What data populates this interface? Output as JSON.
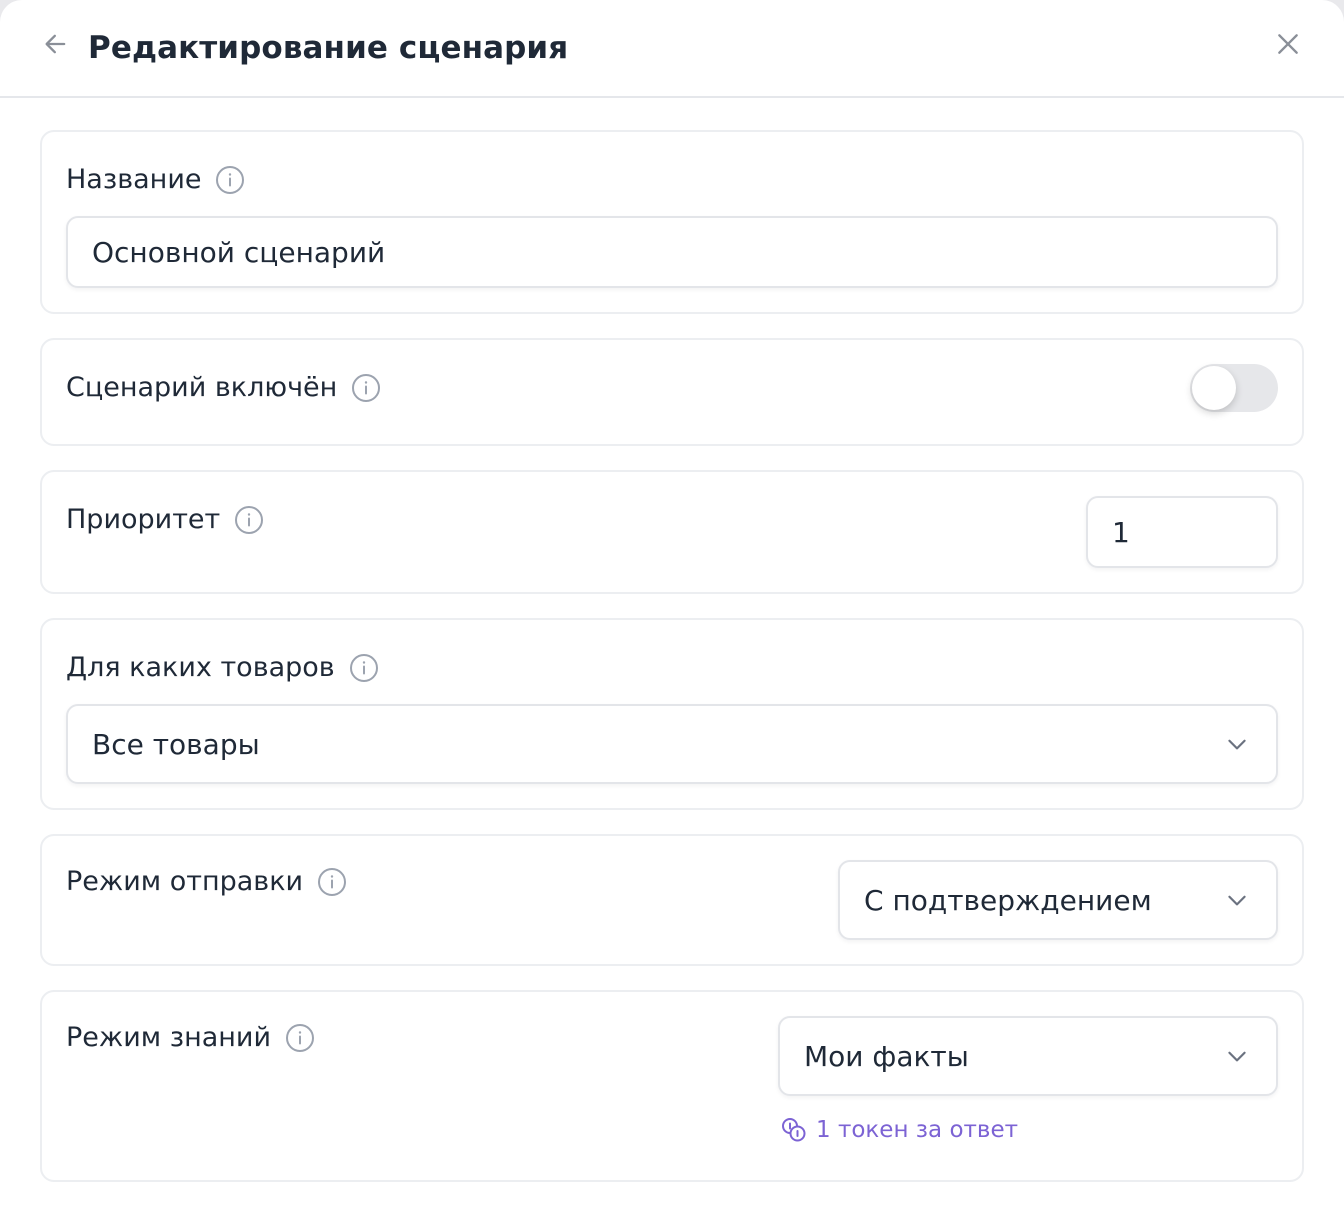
{
  "header": {
    "title": "Редактирование сценария"
  },
  "name_section": {
    "label": "Название",
    "value": "Основной сценарий"
  },
  "enabled_section": {
    "label": "Сценарий включён",
    "enabled": false
  },
  "priority_section": {
    "label": "Приоритет",
    "value": "1"
  },
  "products_section": {
    "label": "Для каких товаров",
    "selected": "Все товары"
  },
  "send_mode_section": {
    "label": "Режим отправки",
    "selected": "С подтверждением"
  },
  "knowledge_section": {
    "label": "Режим знаний",
    "selected": "Мои факты",
    "token_note": "1 токен за ответ"
  },
  "colors": {
    "accent": "#7c63d4",
    "text": "#1f2937",
    "muted_icon": "#9ca3af",
    "border": "#e3e5e9"
  }
}
